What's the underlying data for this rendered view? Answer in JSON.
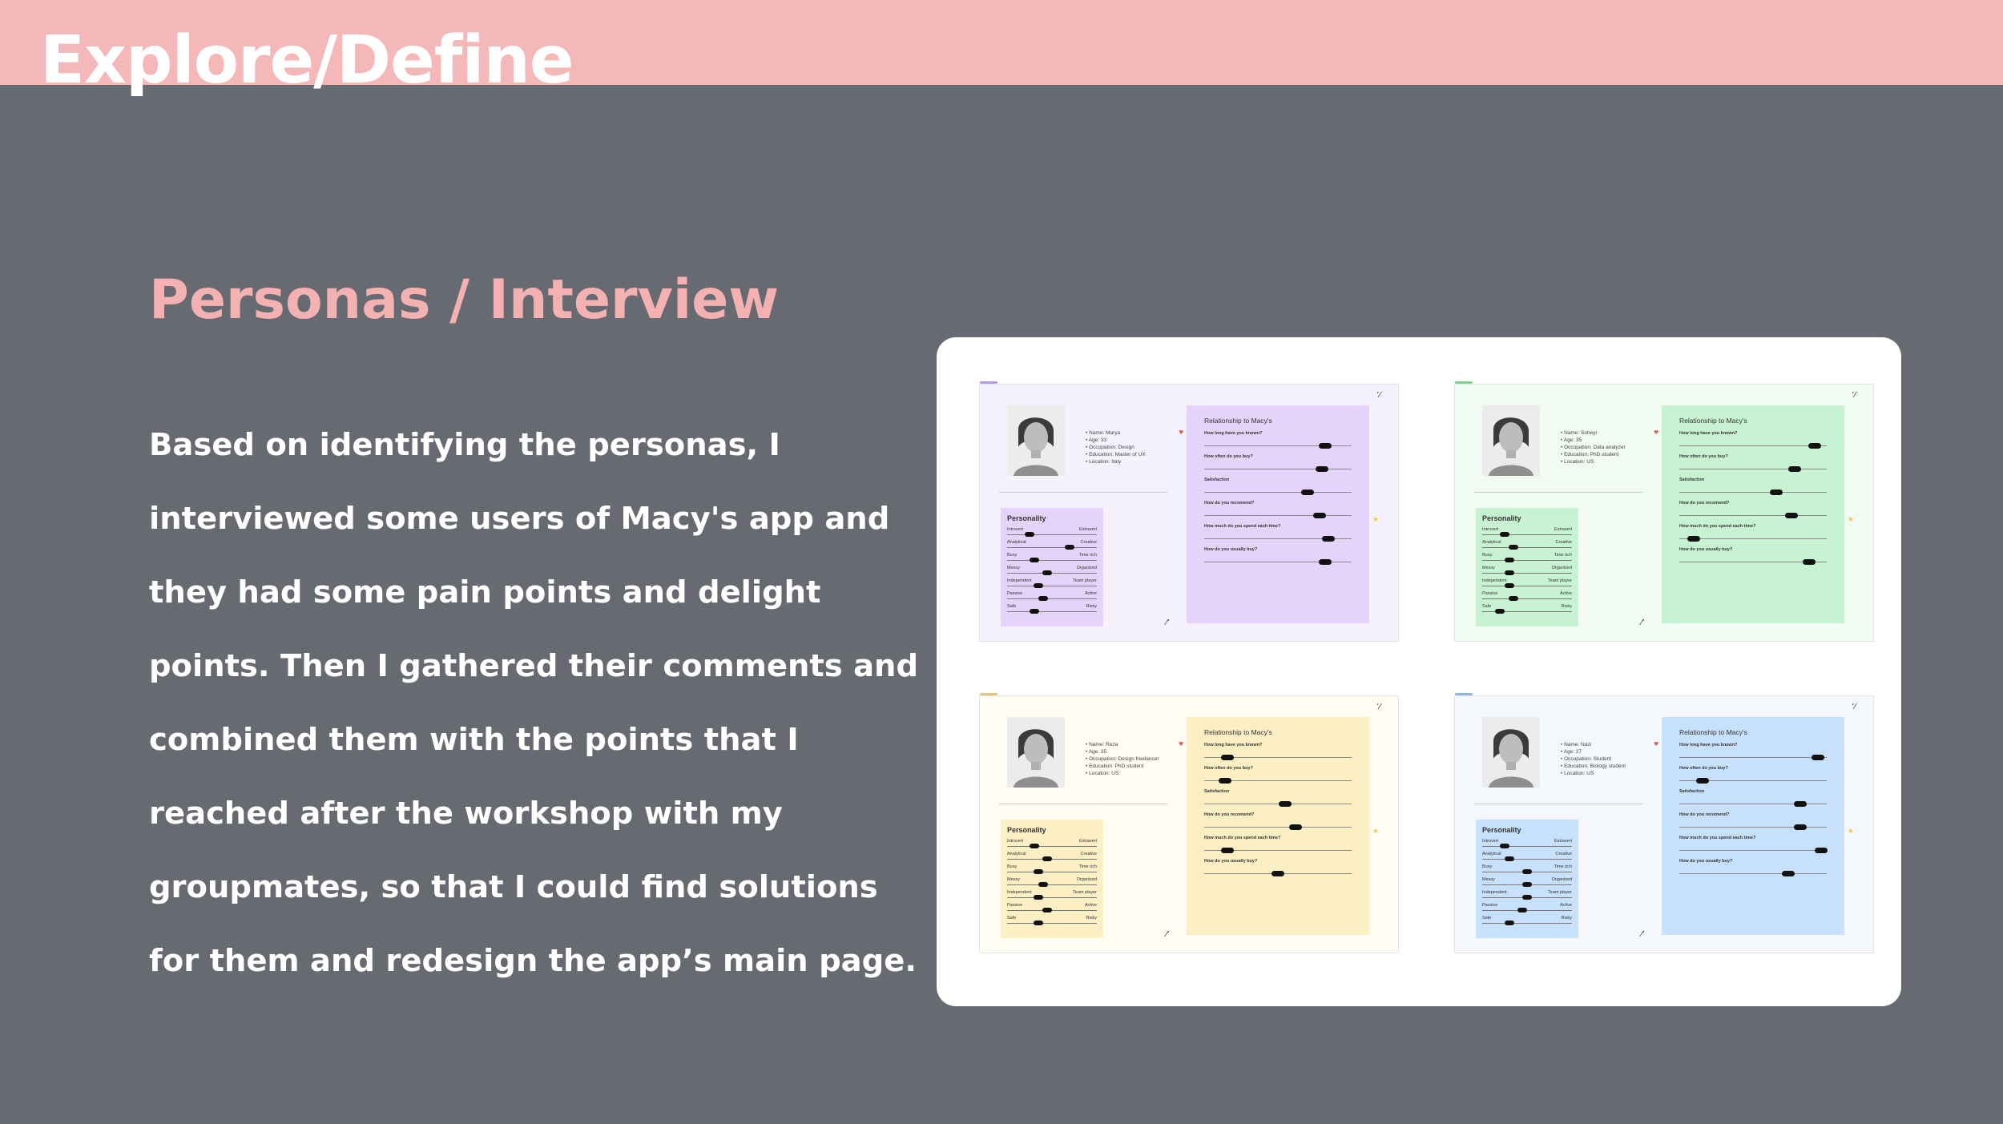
{
  "header": {
    "title": "Explore/Define",
    "bar_color": "#f4b8b8"
  },
  "main": {
    "heading": "Personas / Interview",
    "paragraph": "Based on identifying the personas, I interviewed some users of Macy's app and they had some pain points and delight points. Then I gathered their comments and combined them with the points that I reached after the workshop with my groupmates, so that I could find solutions for them and redesign the app’s main page."
  },
  "colors": {
    "background": "#676a70",
    "accent": "#f4b1b1",
    "panel": "#ffffff"
  },
  "common": {
    "personality_title": "Personality",
    "relationship_title": "Relationship to Macy's",
    "traits": [
      [
        "Introvert",
        "Extravert"
      ],
      [
        "Analytical",
        "Creative"
      ],
      [
        "Busy",
        "Time rich"
      ],
      [
        "Messy",
        "Organized"
      ],
      [
        "Independent",
        "Team player"
      ],
      [
        "Passive",
        "Active"
      ],
      [
        "Safe",
        "Risky"
      ]
    ],
    "questions": [
      "How long have you known?",
      "How often do you buy?",
      "Satisfaction",
      "How do you recomend?",
      "How much do you spend each time?",
      "How do you usually buy?"
    ]
  },
  "personas": [
    {
      "name": "Name: Marya",
      "age": "Age: 33",
      "occupation": "Occupation: Design",
      "education": "Education: Master of UX",
      "location": "Location: Italy",
      "card_bg": "#f6f2fd",
      "box_bg": "#e6d3fb",
      "tick": "#b69be0",
      "traits": [
        0.25,
        0.7,
        0.3,
        0.45,
        0.35,
        0.4,
        0.3
      ],
      "answers": [
        0.82,
        0.8,
        0.7,
        0.78,
        0.84,
        0.82
      ]
    },
    {
      "name": "Name: Soheyl",
      "age": "Age: 35",
      "occupation": "Occupation: Data analyzer",
      "education": "Education: PhD student",
      "location": "Location: US",
      "card_bg": "#f1fbf3",
      "box_bg": "#c8f3d2",
      "tick": "#7fcf95",
      "traits": [
        0.25,
        0.35,
        0.3,
        0.3,
        0.3,
        0.35,
        0.2
      ],
      "answers": [
        0.92,
        0.78,
        0.66,
        0.76,
        0.1,
        0.88
      ]
    },
    {
      "name": "Name: Reza",
      "age": "Age: 35",
      "occupation": "Occupation: Design freelancer",
      "education": "Education: PhD student",
      "location": "Location: US",
      "card_bg": "#fffdf1",
      "box_bg": "#fcefc3",
      "tick": "#e0c77a",
      "traits": [
        0.3,
        0.45,
        0.35,
        0.4,
        0.35,
        0.45,
        0.35
      ],
      "answers": [
        0.16,
        0.14,
        0.55,
        0.62,
        0.16,
        0.5
      ]
    },
    {
      "name": "Name: Nazi",
      "age": "Age: 27",
      "occupation": "Occupation: Student",
      "education": "Education: Biology student",
      "location": "Location: US",
      "card_bg": "#f4f8fd",
      "box_bg": "#c7e0fb",
      "tick": "#8db7e6",
      "traits": [
        0.25,
        0.3,
        0.5,
        0.5,
        0.5,
        0.45,
        0.3
      ],
      "answers": [
        0.94,
        0.16,
        0.82,
        0.82,
        0.96,
        0.74
      ]
    }
  ]
}
